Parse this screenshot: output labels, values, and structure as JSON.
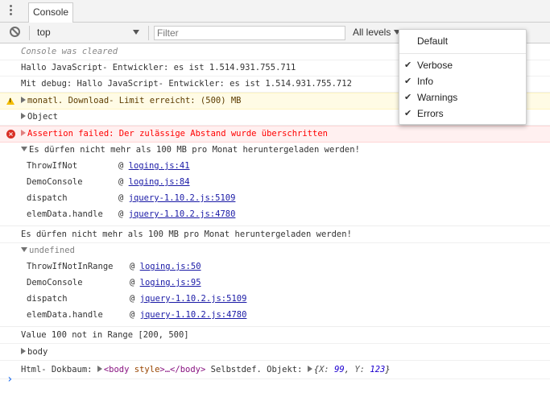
{
  "tabbar": {
    "tab_label": "Console"
  },
  "toolbar": {
    "context": "top",
    "filter_placeholder": "Filter",
    "levels": "All levels"
  },
  "levels_menu": {
    "default_label": "Default",
    "items": [
      {
        "label": "Verbose",
        "checked": true
      },
      {
        "label": "Info",
        "checked": true
      },
      {
        "label": "Warnings",
        "checked": true
      },
      {
        "label": "Errors",
        "checked": true
      }
    ],
    "check_glyph": "✔"
  },
  "console": {
    "cleared": "Console was cleared",
    "log1": "Hallo JavaScript- Entwickler: es ist 1.514.931.755.711",
    "log2": "Mit debug: Hallo JavaScript- Entwickler: es ist 1.514.931.755.712",
    "warning": "monatl. Download- Limit erreicht: (500) MB",
    "object": "Object",
    "error": "Assertion failed: Der zulässige Abstand wurde überschritten",
    "trace_msg_1": "Es dürfen nicht mehr als 100 MB pro Monat heruntergeladen werden!",
    "trace1": [
      {
        "fn": "ThrowIfNot",
        "at": "@",
        "link": "loging.js:41"
      },
      {
        "fn": "DemoConsole",
        "at": "@",
        "link": "loging.js:84"
      },
      {
        "fn": "dispatch",
        "at": "@",
        "link": "jquery-1.10.2.js:5109"
      },
      {
        "fn": "elemData.handle",
        "at": "@",
        "link": "jquery-1.10.2.js:4780"
      }
    ],
    "msg_2": "Es dürfen nicht mehr als 100 MB pro Monat heruntergeladen werden!",
    "undefined": "undefined",
    "trace2": [
      {
        "fn": "ThrowIfNotInRange",
        "at": "@",
        "link": "loging.js:50"
      },
      {
        "fn": "DemoConsole",
        "at": "@",
        "link": "loging.js:95"
      },
      {
        "fn": "dispatch",
        "at": "@",
        "link": "jquery-1.10.2.js:5109"
      },
      {
        "fn": "elemData.handle",
        "at": "@",
        "link": "jquery-1.10.2.js:4780"
      }
    ],
    "range": "Value 100 not in Range [200, 500]",
    "body": "body",
    "html_prefix": "Html- Dokbaum:",
    "html_tag_open": "<body",
    "html_attr": "style",
    "html_ellipsis": ">…",
    "html_tag_close": "</body>",
    "selbst_label": "Selbstdef. Objekt:",
    "obj_open": "{",
    "obj_x_key": "X:",
    "obj_x_val": "99",
    "obj_sep": ",",
    "obj_y_key": "Y:",
    "obj_y_val": "123",
    "obj_close": "}"
  },
  "prompt": "›"
}
